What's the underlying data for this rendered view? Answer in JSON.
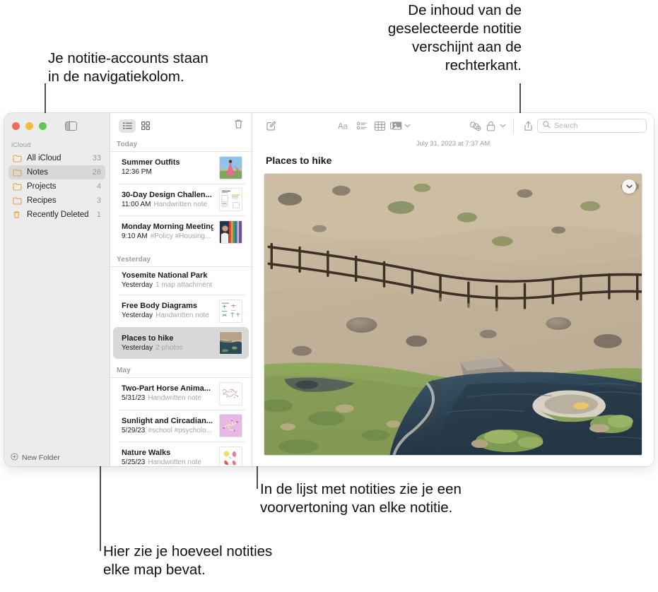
{
  "callouts": {
    "accounts": "Je notitie-accounts staan\nin de navigatiekolom.",
    "content": "De inhoud van de\ngeselecteerde notitie\nverschijnt aan de\nrechterkant.",
    "preview": "In de lijst met notities zie je een\nvoorvertoning van elke notitie.",
    "counts": "Hier zie je hoeveel notities\nelke map bevat."
  },
  "sidebar": {
    "section_label": "iCloud",
    "items": [
      {
        "label": "All iCloud",
        "count": "33",
        "icon": "folder-icon",
        "selected": false
      },
      {
        "label": "Notes",
        "count": "26",
        "icon": "folder-icon",
        "selected": true
      },
      {
        "label": "Projects",
        "count": "4",
        "icon": "folder-icon",
        "selected": false
      },
      {
        "label": "Recipes",
        "count": "3",
        "icon": "folder-icon",
        "selected": false
      },
      {
        "label": "Recently Deleted",
        "count": "1",
        "icon": "trash-icon",
        "selected": false
      }
    ],
    "new_folder_label": "New Folder",
    "traffic_lights": {
      "close": "#f1695e",
      "minimize": "#f6bd3d",
      "zoom": "#62c655"
    }
  },
  "noteslist": {
    "toolbar": {
      "list_view_icon": "list-view-icon",
      "gallery_view_icon": "gallery-view-icon",
      "delete_icon": "trash-icon",
      "active_view": "list"
    },
    "groups": [
      {
        "label": "Today",
        "notes": [
          {
            "title": "Summer Outfits",
            "date": "12:36 PM",
            "sub": "",
            "thumb": "photo-person-pink-dress",
            "selected": false
          },
          {
            "title": "30-Day Design Challen...",
            "date": "11:00 AM",
            "sub": "Handwritten note",
            "thumb": "doc-sketch-page",
            "selected": false
          },
          {
            "title": "Monday Morning Meeting",
            "date": "9:10 AM",
            "sub": "#Policy #Housing...",
            "thumb": "photo-person-ribbons",
            "selected": false
          }
        ]
      },
      {
        "label": "Yesterday",
        "notes": [
          {
            "title": "Yosemite National Park",
            "date": "Yesterday",
            "sub": "1 map attachment",
            "thumb": "",
            "selected": false
          },
          {
            "title": "Free Body Diagrams",
            "date": "Yesterday",
            "sub": "Handwritten note",
            "thumb": "doc-diagrams",
            "selected": false
          },
          {
            "title": "Places to hike",
            "date": "Yesterday",
            "sub": "2 photos",
            "thumb": "photo-landscape-river",
            "selected": true
          }
        ]
      },
      {
        "label": "May",
        "notes": [
          {
            "title": "Two-Part Horse Anima...",
            "date": "5/31/23",
            "sub": "Handwritten note",
            "thumb": "doc-horse-sketch",
            "selected": false
          },
          {
            "title": "Sunlight and Circadian...",
            "date": "5/29/23",
            "sub": "#school #psycholo...",
            "thumb": "photo-pink-molecule",
            "selected": false
          },
          {
            "title": "Nature Walks",
            "date": "5/25/23",
            "sub": "Handwritten note",
            "thumb": "doc-leaves-sketch",
            "selected": false
          }
        ]
      }
    ]
  },
  "detail": {
    "toolbar": {
      "compose_icon": "compose-note-icon",
      "format_icon": "format-text-icon",
      "checklist_icon": "checklist-icon",
      "table_icon": "table-icon",
      "media_icon": "media-icon",
      "media_chevron_icon": "chevron-down-icon",
      "collaborate_icon": "add-collaborator-icon",
      "lock_icon": "lock-icon",
      "lock_chevron_icon": "chevron-down-icon",
      "share_icon": "share-icon",
      "search_icon": "search-icon"
    },
    "search_placeholder": "Search",
    "search_value": "",
    "note_date": "July 31, 2023 at 7:37 AM",
    "note_title": "Places to hike",
    "photo_menu_icon": "chevron-down-icon",
    "photo_alt": "hot-springs-river-landscape"
  }
}
